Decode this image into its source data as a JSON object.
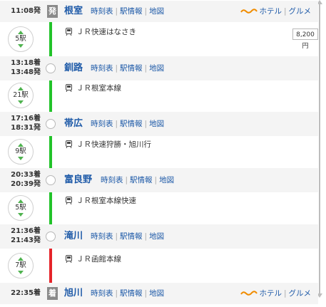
{
  "route": {
    "link_labels": {
      "timetable": "時刻表",
      "station_info": "駅情報",
      "map": "地図",
      "sep": "|"
    },
    "hotel_labels": {
      "hotel": "ホテル",
      "sep": "|",
      "gourmet": "グルメ"
    },
    "fare": "8,200円",
    "line_colors": {
      "green": "#22c32a",
      "red": "#e5242a"
    },
    "stations": [
      {
        "name": "根室",
        "badge": "発",
        "time1": "11:08発",
        "time2": ""
      },
      {
        "name": "釧路",
        "badge": "",
        "time1": "13:18着",
        "time2": "13:48発"
      },
      {
        "name": "帯広",
        "badge": "",
        "time1": "17:16着",
        "time2": "18:31発"
      },
      {
        "name": "富良野",
        "badge": "",
        "time1": "20:33着",
        "time2": "20:39発"
      },
      {
        "name": "滝川",
        "badge": "",
        "time1": "21:36着",
        "time2": "21:43発"
      },
      {
        "name": "旭川",
        "badge": "着",
        "time1": "22:35着",
        "time2": ""
      }
    ],
    "segments": [
      {
        "stops": "5駅",
        "line": "ＪＲ快速はなさき",
        "color": "green"
      },
      {
        "stops": "21駅",
        "line": "ＪＲ根室本線",
        "color": "green"
      },
      {
        "stops": "9駅",
        "line": "ＪＲ快速狩勝・旭川行",
        "color": "green"
      },
      {
        "stops": "5駅",
        "line": "ＪＲ根室本線快速",
        "color": "green"
      },
      {
        "stops": "7駅",
        "line": "ＪＲ函館本線",
        "color": "red"
      }
    ]
  }
}
